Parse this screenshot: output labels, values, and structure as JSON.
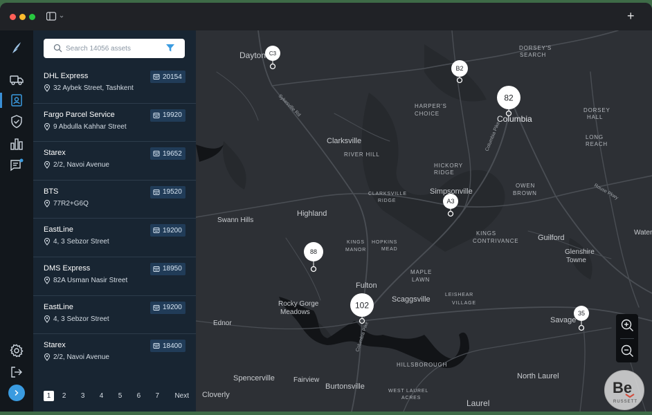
{
  "titlebar": {
    "plus_label": "+"
  },
  "search": {
    "placeholder": "Search 14056 assets"
  },
  "assets": [
    {
      "name": "DHL Express",
      "address": "32 Aybek Street, Tashkent",
      "id": "20154"
    },
    {
      "name": "Fargo Parcel Service",
      "address": "9 Abdulla Kahhar Street",
      "id": "19920"
    },
    {
      "name": "Starex",
      "address": "2/2, Navoi Avenue",
      "id": "19652"
    },
    {
      "name": "BTS",
      "address": "77R2+G6Q",
      "id": "19520"
    },
    {
      "name": "EastLine",
      "address": "4, 3 Sebzor Street",
      "id": "19200"
    },
    {
      "name": "DMS Express",
      "address": "82A Usman Nasir Street",
      "id": "18950"
    },
    {
      "name": "EastLine",
      "address": "4, 3 Sebzor Street",
      "id": "19200"
    },
    {
      "name": "Starex",
      "address": "2/2, Navoi Avenue",
      "id": "18400"
    }
  ],
  "pagination": {
    "pages": [
      "1",
      "2",
      "3",
      "4",
      "5",
      "6",
      "7"
    ],
    "active": "1",
    "next_label": "Next"
  },
  "map": {
    "places": [
      {
        "label": "Dayton"
      },
      {
        "label": "DORSEY'S"
      },
      {
        "label": "SEARCH"
      },
      {
        "label": "HARPER'S"
      },
      {
        "label": "CHOICE"
      },
      {
        "label": "Columbia"
      },
      {
        "label": "Clarksville"
      },
      {
        "label": "RIVER HILL"
      },
      {
        "label": "HICKORY"
      },
      {
        "label": "RIDGE"
      },
      {
        "label": "DORSEY"
      },
      {
        "label": "HALL"
      },
      {
        "label": "LONG"
      },
      {
        "label": "REACH"
      },
      {
        "label": "CLARKSVILLE"
      },
      {
        "label": "RIDGE"
      },
      {
        "label": "Simpsonville"
      },
      {
        "label": "OWEN"
      },
      {
        "label": "BROWN"
      },
      {
        "label": "Highland"
      },
      {
        "label": "Swann Hills"
      },
      {
        "label": "KINGS"
      },
      {
        "label": "CONTRIVANCE"
      },
      {
        "label": "Guilford"
      },
      {
        "label": "Glenshire"
      },
      {
        "label": "Towne"
      },
      {
        "label": "Water"
      },
      {
        "label": "HOPKINS"
      },
      {
        "label": "MEAD"
      },
      {
        "label": "KINGS"
      },
      {
        "label": "MANOR"
      },
      {
        "label": "MAPLE"
      },
      {
        "label": "LAWN"
      },
      {
        "label": "Fulton"
      },
      {
        "label": "Rocky Gorge"
      },
      {
        "label": "Meadows"
      },
      {
        "label": "Scaggsville"
      },
      {
        "label": "LEISHEAR"
      },
      {
        "label": "VILLAGE"
      },
      {
        "label": "Ednor"
      },
      {
        "label": "Savage"
      },
      {
        "label": "HILLSBOROUGH"
      },
      {
        "label": "North Laurel"
      },
      {
        "label": "Spencerville"
      },
      {
        "label": "Fairview"
      },
      {
        "label": "Burtonsville"
      },
      {
        "label": "Cloverly"
      },
      {
        "label": "WEST LAUREL"
      },
      {
        "label": "ACRES"
      },
      {
        "label": "Laurel"
      },
      {
        "label": "Sykesville Rd"
      },
      {
        "label": "Columbia Pike"
      },
      {
        "label": "Columbia Pike"
      },
      {
        "label": "Rouse Pkwy"
      }
    ],
    "markers": [
      {
        "label": "C3"
      },
      {
        "label": "B2"
      },
      {
        "label": "82"
      },
      {
        "label": "A3"
      },
      {
        "label": "88"
      },
      {
        "label": "102"
      },
      {
        "label": "35"
      }
    ]
  },
  "watermark": {
    "letters": "Be",
    "subtext": "RUSSETT"
  },
  "colors": {
    "accent": "#3a9be0",
    "panel": "#182532",
    "badge": "#213c58",
    "map": "#2d3035"
  }
}
